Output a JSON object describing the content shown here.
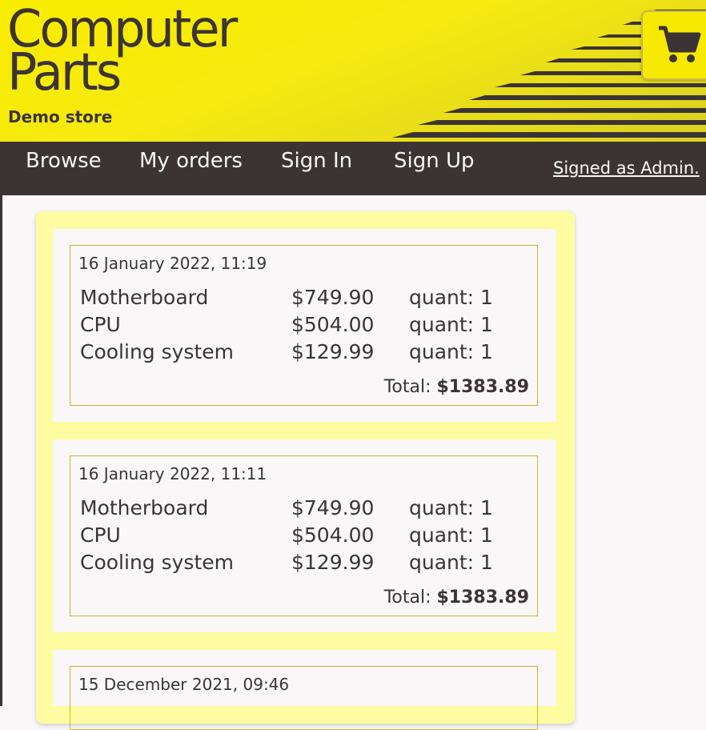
{
  "header": {
    "logo_line1": "Computer",
    "logo_line2": "Parts",
    "subtitle": "Demo store",
    "cart_icon": "shopping-cart-icon"
  },
  "nav": {
    "items": [
      {
        "label": "Browse"
      },
      {
        "label": "My orders"
      },
      {
        "label": "Sign In"
      },
      {
        "label": "Sign Up"
      }
    ],
    "user_label": "Signed as Admin."
  },
  "orders": [
    {
      "date": "16 January 2022, 11:19",
      "items": [
        {
          "name": "Motherboard",
          "price": "$749.90",
          "qty": "quant: 1"
        },
        {
          "name": "CPU",
          "price": "$504.00",
          "qty": "quant: 1"
        },
        {
          "name": "Cooling system",
          "price": "$129.99",
          "qty": "quant: 1"
        }
      ],
      "total_label": "Total:",
      "total_value": "$1383.89"
    },
    {
      "date": "16 January 2022, 11:11",
      "items": [
        {
          "name": "Motherboard",
          "price": "$749.90",
          "qty": "quant: 1"
        },
        {
          "name": "CPU",
          "price": "$504.00",
          "qty": "quant: 1"
        },
        {
          "name": "Cooling system",
          "price": "$129.99",
          "qty": "quant: 1"
        }
      ],
      "total_label": "Total:",
      "total_value": "$1383.89"
    },
    {
      "date": "15 December 2021, 09:46"
    }
  ],
  "colors": {
    "brand_yellow": "#f8ec00",
    "dark": "#3c3434",
    "panel_yellow": "#fdfca0",
    "card_bg": "#f9f7f8"
  }
}
